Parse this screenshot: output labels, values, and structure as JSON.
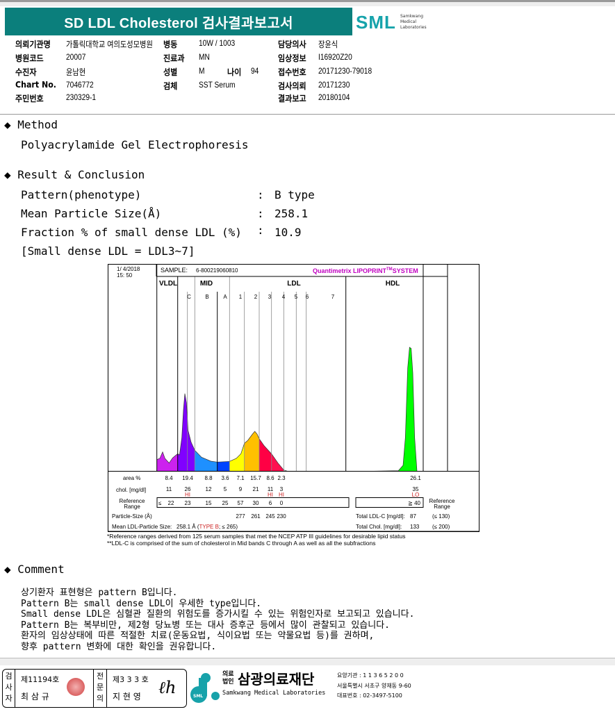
{
  "header": {
    "title": "SD LDL Cholesterol 검사결과보고서",
    "logo": "SML",
    "logo_sub": "Samkwang Medical Laboratories"
  },
  "info": [
    [
      {
        "label": "의뢰기관명",
        "value": "가톨릭대학교 여의도성모병원"
      },
      {
        "label": "병동",
        "value": "10W / 1003"
      },
      {
        "label": "담당의사",
        "value": "장윤식"
      }
    ],
    [
      {
        "label": "병원코드",
        "value": "20007"
      },
      {
        "label": "진료과",
        "value": "MN"
      },
      {
        "label": "임상정보",
        "value": "I16920Z20"
      }
    ],
    [
      {
        "label": "수진자",
        "value": "윤남현"
      },
      {
        "label": "성별",
        "value": "M"
      },
      {
        "label": "접수번호",
        "value": "20171230-79018"
      }
    ],
    [
      {
        "label": "Chart No.",
        "value": "7046772"
      },
      {
        "label": "검체",
        "value": "SST Serum"
      },
      {
        "label": "검사의뢰",
        "value": "20171230"
      }
    ],
    [
      {
        "label": "주민번호",
        "value": "230329-1"
      },
      null,
      {
        "label": "결과보고",
        "value": "20180104"
      }
    ]
  ],
  "age": {
    "label": "나이",
    "value": "94"
  },
  "method": {
    "heading": "Method",
    "text": "Polyacrylamide Gel Electrophoresis"
  },
  "result": {
    "heading": "Result & Conclusion",
    "rows": [
      {
        "label": "Pattern(phenotype)",
        "value": "B type"
      },
      {
        "label": "Mean Particle Size(Å)",
        "value": "258.1"
      },
      {
        "label": "Fraction % of small dense LDL (%)",
        "value": "10.9"
      }
    ],
    "note": "[Small dense LDL = LDL3~7]",
    "colon": ":"
  },
  "chart_data": {
    "type": "area",
    "date": "1/ 4/2018",
    "time": "15: 50",
    "sample_label": "SAMPLE:",
    "sample_id": "6-800219060810",
    "system": "Quantimetrix LIPOPRINT",
    "system_tm": "TM",
    "system_suffix": "SYSTEM",
    "groups": [
      "VLDL",
      "MID",
      "LDL",
      "HDL"
    ],
    "bands": [
      "C",
      "B",
      "A",
      "1",
      "2",
      "3",
      "4",
      "5",
      "6",
      "7"
    ],
    "colors": {
      "VLDL": "#cc22ee",
      "C": "#8000ff",
      "B": "#1e90ff",
      "A": "#0044ff",
      "1": "#ffff00",
      "2": "#ffc000",
      "3": "#ff0044",
      "4": "#ff1050",
      "HDL": "#00ff00"
    },
    "area_label": "area %",
    "area": [
      "8.4",
      "19.4",
      "8.8",
      "3.6",
      "7.1",
      "15.7",
      "8.6",
      "2.3"
    ],
    "hdl_area": "26.1",
    "chol_label": "chol. [mg/dl]",
    "chol": [
      "11",
      "26",
      "12",
      "5",
      "9",
      "21",
      "11",
      "3"
    ],
    "hdl_chol": "35",
    "flags": [
      "",
      "HI",
      "",
      "",
      "",
      "",
      "HI",
      "HI"
    ],
    "hdl_flag": "LO",
    "ref_label": "Reference Range",
    "ref_le": "≤",
    "ref": [
      "22",
      "23",
      "15",
      "25",
      "57",
      "30",
      "6",
      "0"
    ],
    "hdl_ref": "≧ 40",
    "size_label": "Particle-Size (Å)",
    "sizes": [
      "277",
      "261",
      "245",
      "230"
    ],
    "mean_label": "Mean LDL-Particle Size:",
    "mean_value": "258.1 Å",
    "mean_type": "TYPE B",
    "mean_ref": "; ≤ 265)",
    "mean_open": "(",
    "ldl_label": "Total LDL-C [mg/dl]:",
    "ldl_value": "87",
    "ldl_ref": "(≤ 130)",
    "chol_total_label": "Total Chol. [mg/dl]:",
    "chol_total_value": "133",
    "chol_total_ref": "(≤ 200)",
    "footnote1": "*Reference ranges derived from 125 serum samples that met the NCEP ATP III guidelines for desirable lipid status",
    "footnote2": "**LDL-C is comprised of the sum of cholesterol in Mid bands C through A as well as all the subfractions"
  },
  "comment": {
    "heading": "Comment",
    "lines": [
      "상기환자 표현형은 pattern B입니다.",
      "Pattern B는 small dense LDL이 우세한 type입니다.",
      "Small dense LDL은 심혈관 질환의 위험도를 증가시킬 수 있는 위험인자로 보고되고 있습니다.",
      "Pattern B는 복부비만, 제2형 당뇨병 또는 대사 증후군 등에서 많이 관찰되고 있습니다.",
      "환자의 임상상태에 따른 적절한 치료(운동요법, 식이요법 또는 약물요법 등)를 권하며,",
      "향후 pattern 변화에 대한 확인을 권유합니다."
    ]
  },
  "footer": {
    "examiner_label": "검사자",
    "examiner_no": "제11194호",
    "examiner_name": "최 삼 규",
    "doctor_label": "전문의",
    "doctor_no": "제3 3 3 호",
    "doctor_name": "지 현 영",
    "org_type": "의료법인",
    "org_name": "삼광의료재단",
    "org_en": "Samkwang Medical Laboratories",
    "code": "요양기관 : 1 1 3 6 5 2 0 0",
    "address": "서울특별시 서초구 양재동 9-60",
    "phone": "대표번호 : 02-3497-5100"
  }
}
